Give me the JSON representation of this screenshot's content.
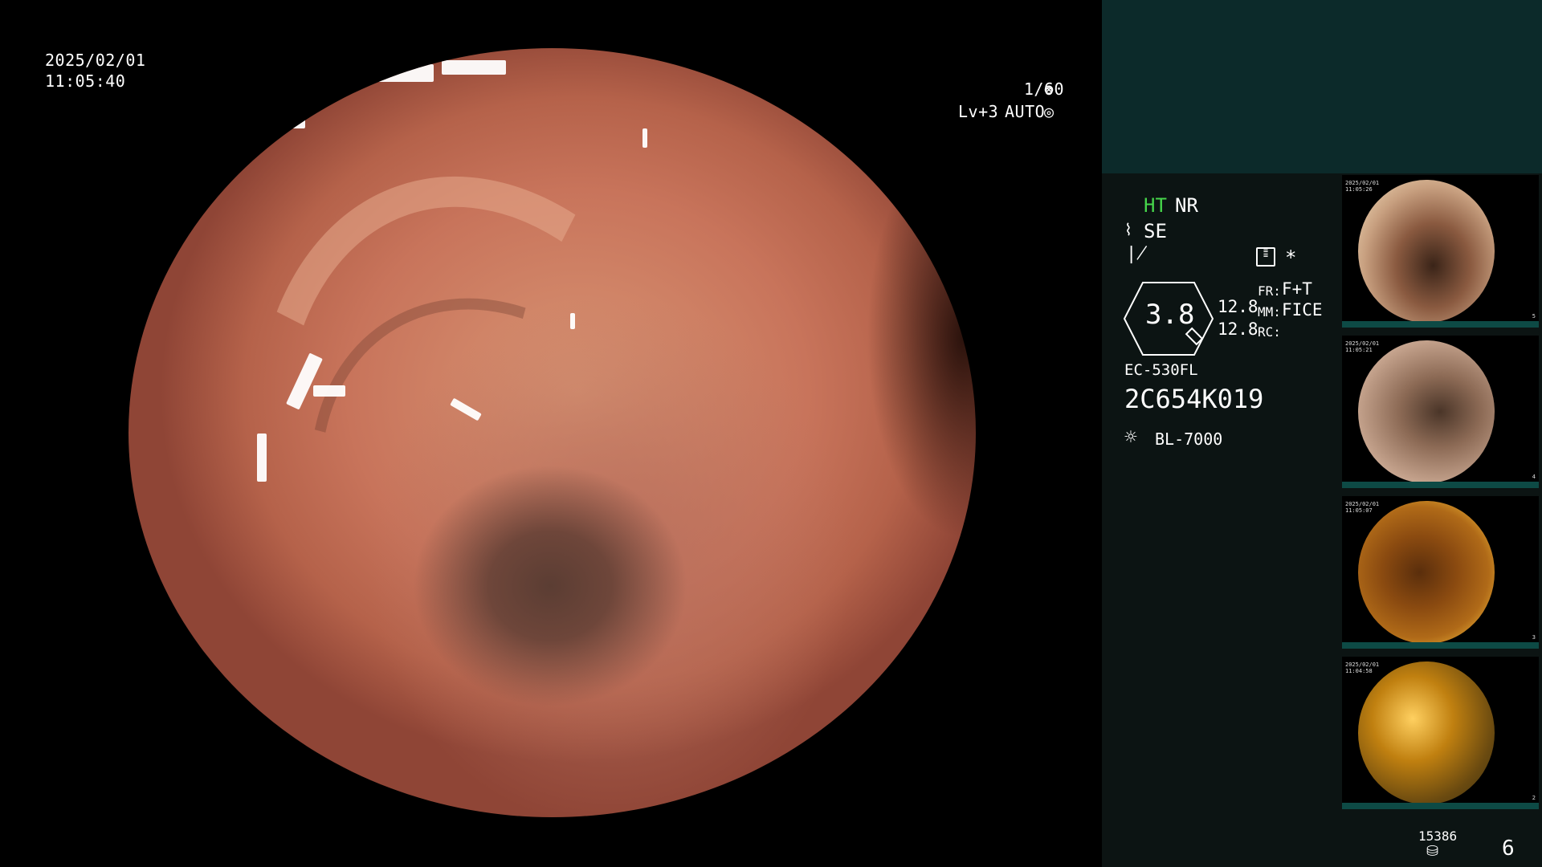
{
  "osd": {
    "date": "2025/02/01",
    "time": "11:05:40",
    "shutter": "1/60",
    "level": "Lv+3",
    "mode": "AUTO"
  },
  "panel": {
    "ht": "HT",
    "nr": "NR",
    "se": "SE",
    "zoom_value": "3.8",
    "val1": "12.8",
    "val2": "12.8",
    "fr_label": "FR:",
    "fr_value": "F+T",
    "mm_label": "MM:",
    "mm_value": "FICE",
    "rc_label": "RC:",
    "scope_model": "EC-530FL",
    "scope_serial": "2C654K019",
    "light_source": "BL-7000",
    "storage_count": "15386",
    "image_count": "6",
    "asterisk": "*"
  },
  "thumbnails": [
    {
      "index": "5",
      "style": "normal"
    },
    {
      "index": "4",
      "style": "normal"
    },
    {
      "index": "3",
      "style": "dark"
    },
    {
      "index": "2",
      "style": "dark"
    }
  ],
  "colors": {
    "ht_green": "#46d64b",
    "panel_teal": "#0c2a2a",
    "panel_bg": "#0c1413"
  },
  "icons": [
    "shutter-icon",
    "auto-iris-icon",
    "menu-icon",
    "light-icon",
    "storage-icon",
    "structure-icon",
    "contrast-icon"
  ]
}
